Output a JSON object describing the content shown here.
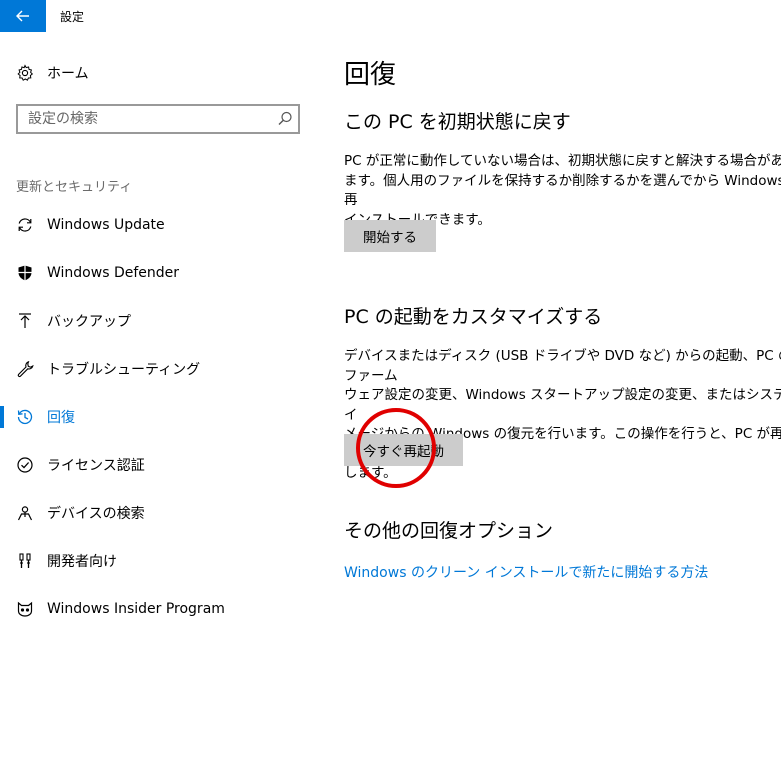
{
  "window": {
    "title": "設定"
  },
  "sidebar": {
    "home_label": "ホーム",
    "search": {
      "placeholder": "設定の検索",
      "value": ""
    },
    "section_heading": "更新とセキュリティ",
    "items": [
      {
        "label": "Windows Update",
        "icon": "refresh-icon"
      },
      {
        "label": "Windows Defender",
        "icon": "shield-icon"
      },
      {
        "label": "バックアップ",
        "icon": "upload-arrow-icon"
      },
      {
        "label": "トラブルシューティング",
        "icon": "wrench-icon"
      },
      {
        "label": "回復",
        "icon": "history-icon",
        "selected": true
      },
      {
        "label": "ライセンス認証",
        "icon": "check-circle-icon"
      },
      {
        "label": "デバイスの検索",
        "icon": "person-pin-icon"
      },
      {
        "label": "開発者向け",
        "icon": "developer-tools-icon"
      },
      {
        "label": "Windows Insider Program",
        "icon": "insider-cat-icon"
      }
    ]
  },
  "main": {
    "title": "回復",
    "reset": {
      "heading": "この PC を初期状態に戻す",
      "lines": [
        "PC が正常に動作していない場合は、初期状態に戻すと解決する場合があ",
        "ます。個人用のファイルを保持するか削除するかを選んでから Windows を再",
        "インストールできます。"
      ],
      "button_label": "開始する"
    },
    "advanced": {
      "heading": "PC の起動をカスタマイズする",
      "lines": [
        "デバイスまたはディスク (USB ドライブや DVD など) からの起動、PC のファーム",
        "ウェア設定の変更、Windows スタートアップ設定の変更、またはシステム イ",
        "メージからの Windows の復元を行います。この操作を行うと、PC が再起動",
        "します。"
      ],
      "button_label": "今すぐ再起動"
    },
    "more": {
      "heading": "その他の回復オプション",
      "link_label": "Windows のクリーン インストールで新たに開始する方法"
    }
  },
  "colors": {
    "accent": "#0078d7",
    "highlight": "#e00000",
    "button_bg": "#cccccc"
  }
}
